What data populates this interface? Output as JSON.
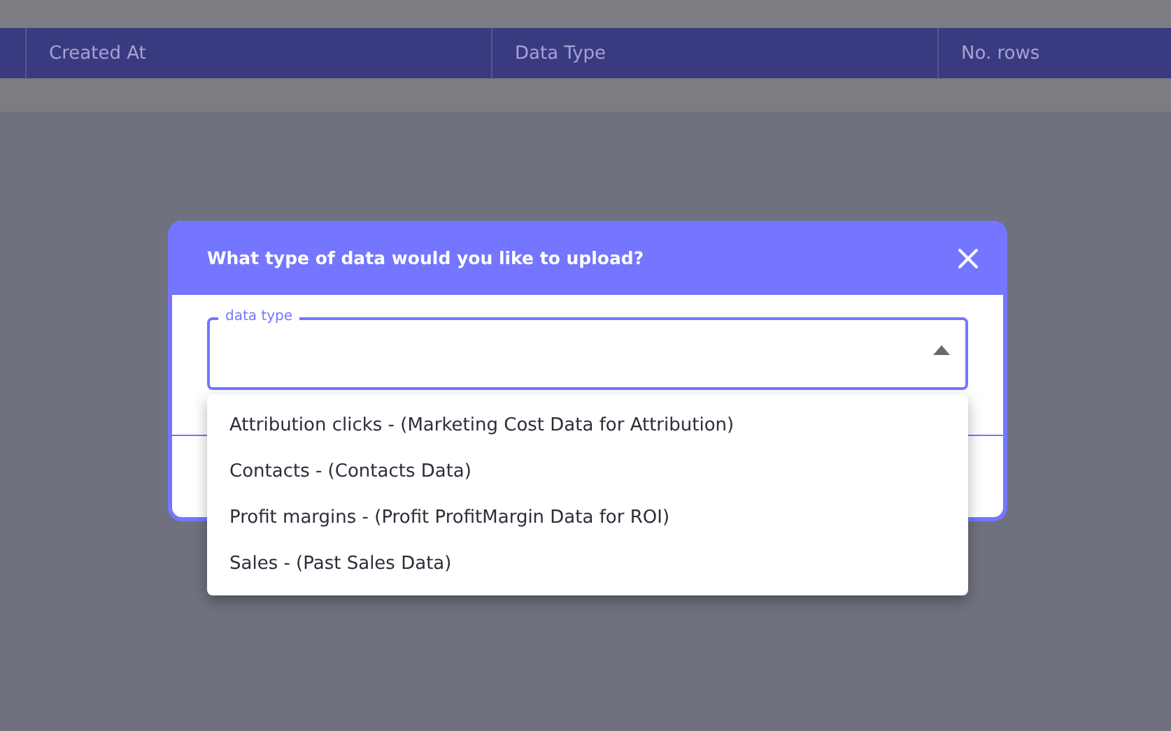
{
  "background_table": {
    "columns": [
      "Created At",
      "Data Type",
      "No. rows"
    ]
  },
  "dialog": {
    "title": "What type of data would you like to upload?",
    "field": {
      "label": "data type",
      "expanded": true
    },
    "options": [
      {
        "label": "Attribution clicks - (Marketing Cost Data for Attribution)"
      },
      {
        "label": "Contacts - (Contacts Data)"
      },
      {
        "label": "Profit margins - (Profit ProfitMargin Data for ROI)"
      },
      {
        "label": "Sales - (Past Sales Data)"
      }
    ]
  }
}
